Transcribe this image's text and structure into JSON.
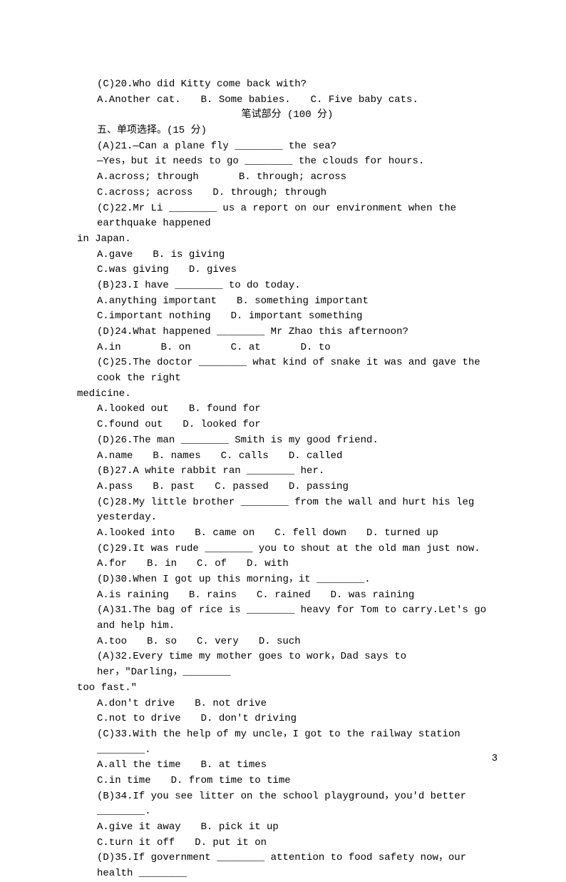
{
  "q20": {
    "prefix": "(C)20.Who did Kitty come back with?",
    "opts": "A.Another cat.　　B. Some babies.　　C. Five baby cats."
  },
  "sectionHeader": "笔试部分 (100 分)",
  "sectionTitle": "五、单项选择。(15 分)",
  "q21": {
    "l1": "(A)21.—Can a plane fly ________ the sea?",
    "l2": "—Yes，but it needs to go ________ the clouds for hours.",
    "o1": "A.across; through　　　　B. through; across",
    "o2": "C.across; across　　D. through; through"
  },
  "q22": {
    "l1": "(C)22.Mr Li ________ us a report on our environment when the earthquake happened",
    "l2": "in Japan.",
    "o1": "A.gave　　B. is giving",
    "o2": "C.was giving　　D. gives"
  },
  "q23": {
    "l1": "(B)23.I have ________ to do today.",
    "o1": "A.anything important　　B. something important",
    "o2": "C.important nothing　　D. important something"
  },
  "q24": {
    "l1": "(D)24.What happened ________ Mr Zhao this afternoon?",
    "o1": "A.in　　　　B. on　　　　C. at　　　　D. to"
  },
  "q25": {
    "l1": "(C)25.The doctor ________ what kind of snake it was and gave the cook the right",
    "l2": "medicine.",
    "o1": "A.looked out　　B. found for",
    "o2": "C.found out　　D. looked for"
  },
  "q26": {
    "l1": "(D)26.The man ________ Smith is my good friend.",
    "o1": "A.name　　B. names　　C. calls　　D. called"
  },
  "q27": {
    "l1": "(B)27.A white rabbit ran ________ her.",
    "o1": "A.pass　　B. past　　C. passed　　D. passing"
  },
  "q28": {
    "l1": "(C)28.My little brother ________ from the wall and hurt his leg yesterday.",
    "o1": "A.looked into　　B. came on　　C. fell down　　D. turned up"
  },
  "q29": {
    "l1": "(C)29.It was rude ________ you to shout at the old man just now.",
    "o1": "A.for　　B. in　　C. of　　D. with"
  },
  "q30": {
    "l1": "(D)30.When I got up this morning，it ________.",
    "o1": "A.is raining　　B. rains　　C. rained　　D. was raining"
  },
  "q31": {
    "l1": "(A)31.The bag of rice is ________ heavy for Tom to carry.Let's go and help him.",
    "o1": "A.too　　B. so　　C. very　　D. such"
  },
  "q32": {
    "l1": "(A)32.Every time my mother goes to work，Dad says to her，\"Darling，________",
    "l2": "too fast.\"",
    "o1": "A.don't drive　　B. not drive",
    "o2": "C.not to drive　　D. don't driving"
  },
  "q33": {
    "l1": "(C)33.With the help of my uncle，I got to the railway station ________.",
    "o1": "A.all the time　　B. at times",
    "o2": "C.in time　　D. from time to time"
  },
  "q34": {
    "l1": "(B)34.If you see litter on the school playground，you'd better ________.",
    "o1": "A.give it away　　B. pick it up",
    "o2": "C.turn it off　　D. put it on"
  },
  "q35": {
    "l1": "(D)35.If government ________ attention to food safety now，our health ________"
  },
  "pageNumber": "3"
}
